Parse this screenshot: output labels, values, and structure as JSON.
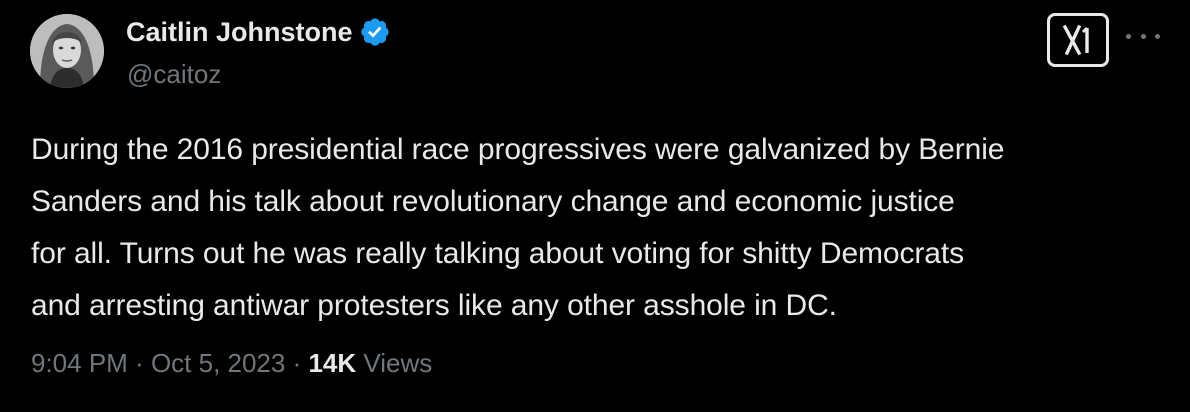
{
  "author": {
    "display_name": "Caitlin Johnstone",
    "handle": "@caitoz",
    "verified": true,
    "avatar_icon": "profile-portrait"
  },
  "tweet": {
    "text": "During the 2016 presidential race progressives were galvanized by Bernie\nSanders and his talk about revolutionary change and economic justice\nfor all. Turns out he was really talking about voting for shitty Democrats\nand arresting antiwar protesters like any other asshole in DC."
  },
  "meta": {
    "time": "9:04 PM",
    "separator": " · ",
    "date": "Oct 5, 2023",
    "views_count": "14K",
    "views_label": " Views"
  },
  "header_icons": {
    "x_logo": "x-logo-icon",
    "more": "more-options-icon"
  },
  "colors": {
    "background": "#000000",
    "primary_text": "#e7e9ea",
    "secondary_text": "#71767b",
    "verified_blue": "#1d9bf0"
  }
}
